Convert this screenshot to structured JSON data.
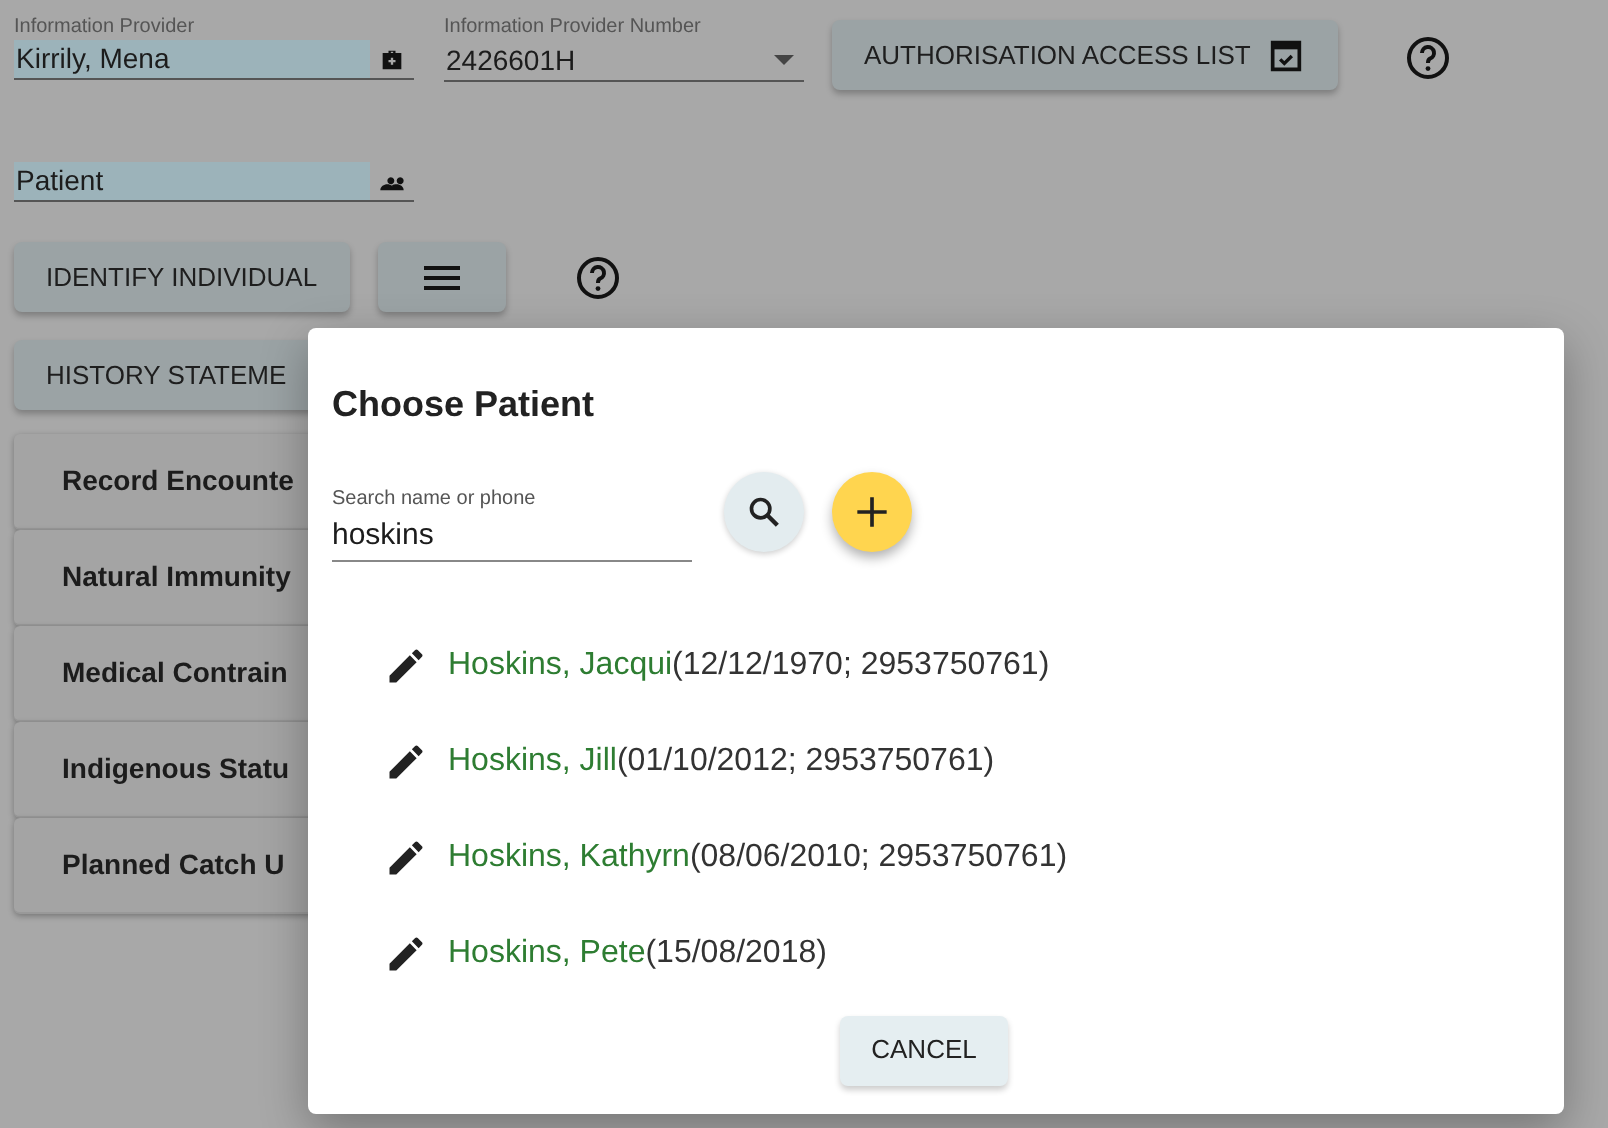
{
  "fields": [
    {
      "kind": "text",
      "label": "Information Provider",
      "value": "Kirrily, Mena",
      "highlighted": true
    },
    {
      "kind": "select",
      "label": "Information Provider Number",
      "value": "2426601H",
      "highlighted": false
    }
  ],
  "authorisation_button": "AUTHORISATION ACCESS LIST",
  "patient_field": {
    "value": "Patient",
    "highlighted": true
  },
  "identify_button": "IDENTIFY INDIVIDUAL",
  "history_button": "HISTORY STATEME",
  "sections": [
    "Record Encounte",
    "Natural Immunity",
    "Medical Contrain",
    "Indigenous Statu",
    "Planned Catch U"
  ],
  "dialog": {
    "title": "Choose Patient",
    "search": {
      "label": "Search name or phone",
      "value": "hoskins"
    },
    "patients": [
      {
        "name": "Hoskins, Jacqui",
        "details": "(12/12/1970; 2953750761)"
      },
      {
        "name": "Hoskins, Jill",
        "details": "(01/10/2012; 2953750761)"
      },
      {
        "name": "Hoskins, Kathyrn",
        "details": "(08/06/2010; 2953750761)"
      },
      {
        "name": "Hoskins, Pete",
        "details": "(15/08/2018)"
      }
    ],
    "cancel": "CANCEL"
  }
}
